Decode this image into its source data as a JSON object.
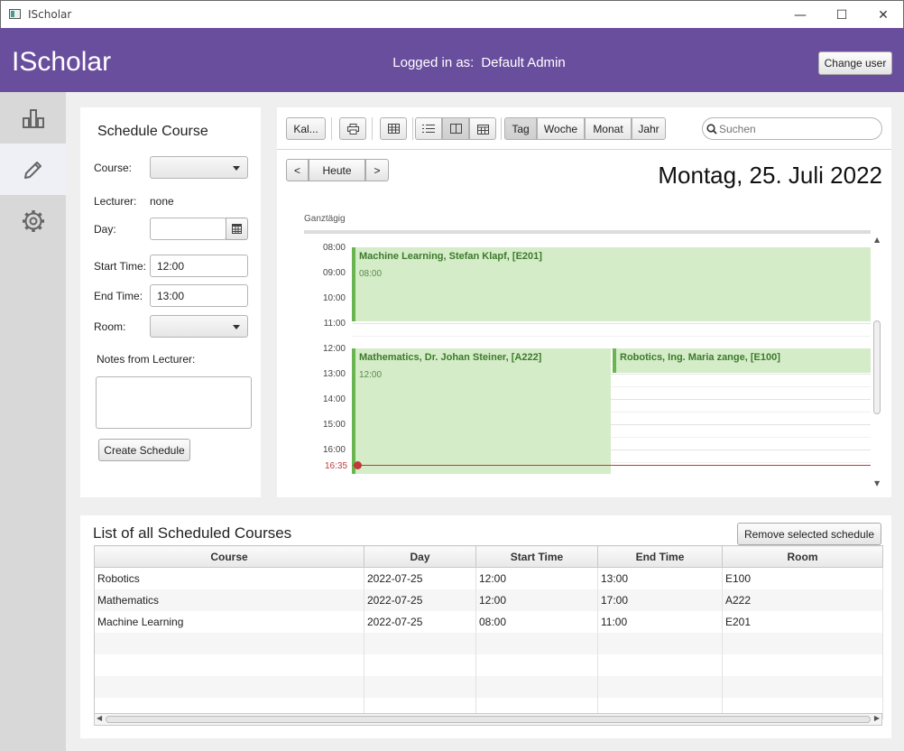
{
  "window": {
    "title": "IScholar",
    "controls": [
      "—",
      "☐",
      "✕"
    ]
  },
  "header": {
    "brand": "IScholar",
    "logged_label": "Logged in as:",
    "user": "Default Admin",
    "change_user": "Change user"
  },
  "colors": {
    "header": "#6a4e9e",
    "event": "#d4ecc8",
    "event_border": "#6ab552",
    "now_line": "#c03a3a"
  },
  "sidebar": {
    "items": [
      {
        "icon": "chart-icon"
      },
      {
        "icon": "edit-icon",
        "active": true
      },
      {
        "icon": "gear-icon"
      }
    ]
  },
  "form": {
    "title": "Schedule Course",
    "course_label": "Course:",
    "lecturer_label": "Lecturer:",
    "lecturer_value": "none",
    "day_label": "Day:",
    "start_label": "Start Time:",
    "start_value": "12:00",
    "end_label": "End Time:",
    "end_value": "13:00",
    "room_label": "Room:",
    "notes_label": "Notes from Lecturer:",
    "create_button": "Create Schedule"
  },
  "calendar": {
    "toolbar": {
      "kal": "Kal...",
      "views": [
        "Tag",
        "Woche",
        "Monat",
        "Jahr"
      ],
      "selected_view": "Tag",
      "search_placeholder": "Suchen"
    },
    "nav": {
      "prev": "<",
      "today": "Heute",
      "next": ">"
    },
    "date_title": "Montag, 25. Juli 2022",
    "allday_label": "Ganztägig",
    "hours": [
      "08:00",
      "09:00",
      "10:00",
      "11:00",
      "12:00",
      "13:00",
      "14:00",
      "15:00",
      "16:00"
    ],
    "now_time": "16:35",
    "events": [
      {
        "title": "Machine Learning, Stefan Klapf, [E201]",
        "start": "08:00"
      },
      {
        "title": "Mathematics, Dr. Johan Steiner, [A222]",
        "start": "12:00"
      },
      {
        "title": "Robotics, Ing. Maria zange, [E100]",
        "start": ""
      }
    ]
  },
  "list": {
    "title": "List of all Scheduled Courses",
    "remove_button": "Remove selected schedule",
    "columns": [
      "Course",
      "Day",
      "Start Time",
      "End Time",
      "Room"
    ],
    "rows": [
      [
        "Robotics",
        "2022-07-25",
        "12:00",
        "13:00",
        "E100"
      ],
      [
        "Mathematics",
        "2022-07-25",
        "12:00",
        "17:00",
        "A222"
      ],
      [
        "Machine Learning",
        "2022-07-25",
        "08:00",
        "11:00",
        "E201"
      ]
    ]
  }
}
